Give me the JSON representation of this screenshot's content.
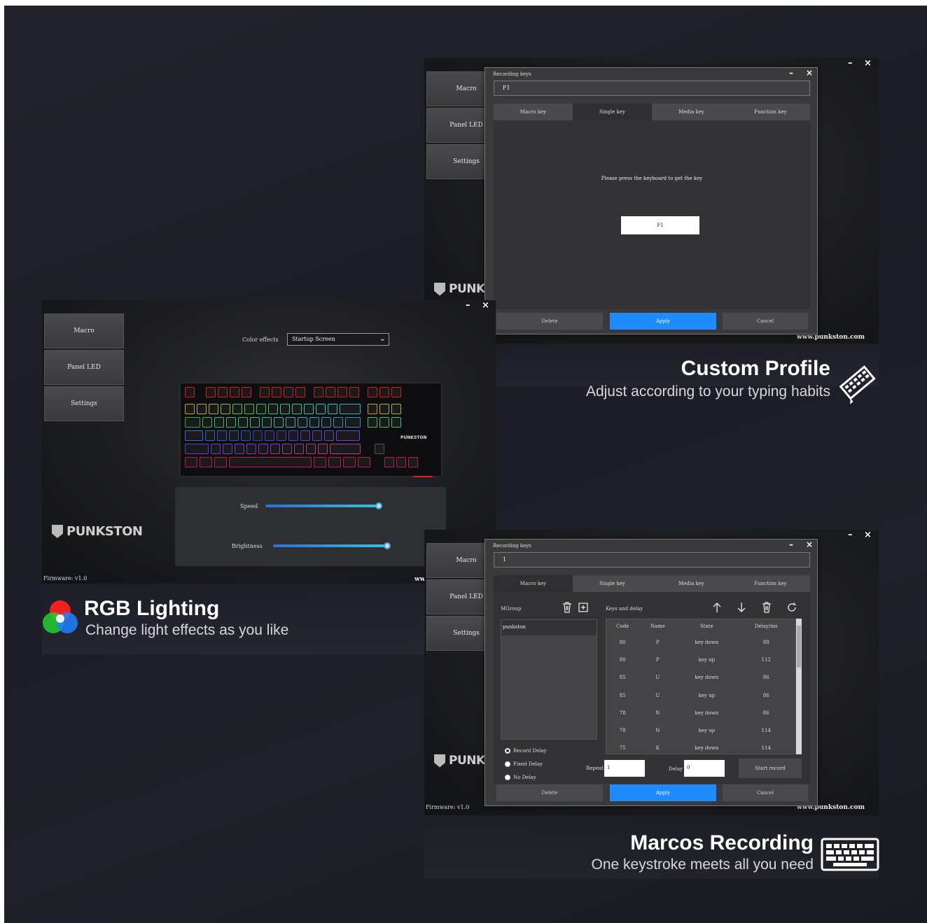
{
  "sidebar": [
    "Macro",
    "Panel LED",
    "Settings"
  ],
  "brand": {
    "logo": "PUNKSTON",
    "website": "www.punkston.com",
    "firmware": "Firmware: v1.0"
  },
  "window_controls": {
    "minimize": "–",
    "close": "×"
  },
  "rgb_window": {
    "color_effects_label": "Color effects",
    "color_effects_value": "Startup Screen",
    "speed_label": "Speed",
    "speed_level": 0.95,
    "brightness_label": "Brightness",
    "brightness_level": 0.97,
    "website_partial": "ww"
  },
  "dialog_common": {
    "title": "Recording keys",
    "tabs": [
      "Macro key",
      "Single key",
      "Media key",
      "Function key"
    ],
    "delete": "Delete",
    "apply": "Apply",
    "cancel": "Cancel"
  },
  "single_key_dialog": {
    "input_value": "F1",
    "active_tab": 1,
    "prompt": "Please press the keyboard to get the key",
    "captured_key": "F1"
  },
  "macro_dialog": {
    "input_value": "1",
    "active_tab": 0,
    "mgroup_label": "MGroup",
    "keys_delay_label": "Keys and delay",
    "group_item": "punkston",
    "columns": [
      "Code",
      "Name",
      "State",
      "Delay/ms"
    ],
    "rows": [
      [
        "80",
        "P",
        "key down",
        "88"
      ],
      [
        "80",
        "P",
        "key up",
        "112"
      ],
      [
        "85",
        "U",
        "key down",
        "86"
      ],
      [
        "85",
        "U",
        "key up",
        "86"
      ],
      [
        "78",
        "N",
        "key down",
        "86"
      ],
      [
        "78",
        "N",
        "key up",
        "114"
      ],
      [
        "75",
        "K",
        "key down",
        "114"
      ]
    ],
    "delay_options": [
      "Record Delay",
      "Fixed Delay",
      "No Delay"
    ],
    "selected_delay": 0,
    "repeat_label": "Repeat",
    "repeat_value": "1",
    "delay_label": "Delay",
    "delay_value": "0",
    "start_record": "Start record"
  },
  "captions": {
    "custom_profile": {
      "title": "Custom Profile",
      "subtitle": "Adjust according to your typing habits"
    },
    "rgb": {
      "title": "RGB Lighting",
      "subtitle": "Change light effects as you like"
    },
    "macros": {
      "title": "Marcos Recording",
      "subtitle": "One keystroke meets all you need"
    }
  },
  "colors": {
    "accent_blue": "#1f8bff",
    "background": "#1e1f28"
  },
  "icons": [
    "trash-icon",
    "plus-box-icon",
    "arrow-up-icon",
    "arrow-down-icon",
    "refresh-icon",
    "pencil-keyboard-icon",
    "rgb-circles-icon",
    "keyboard-icon",
    "chevron-down-icon"
  ]
}
